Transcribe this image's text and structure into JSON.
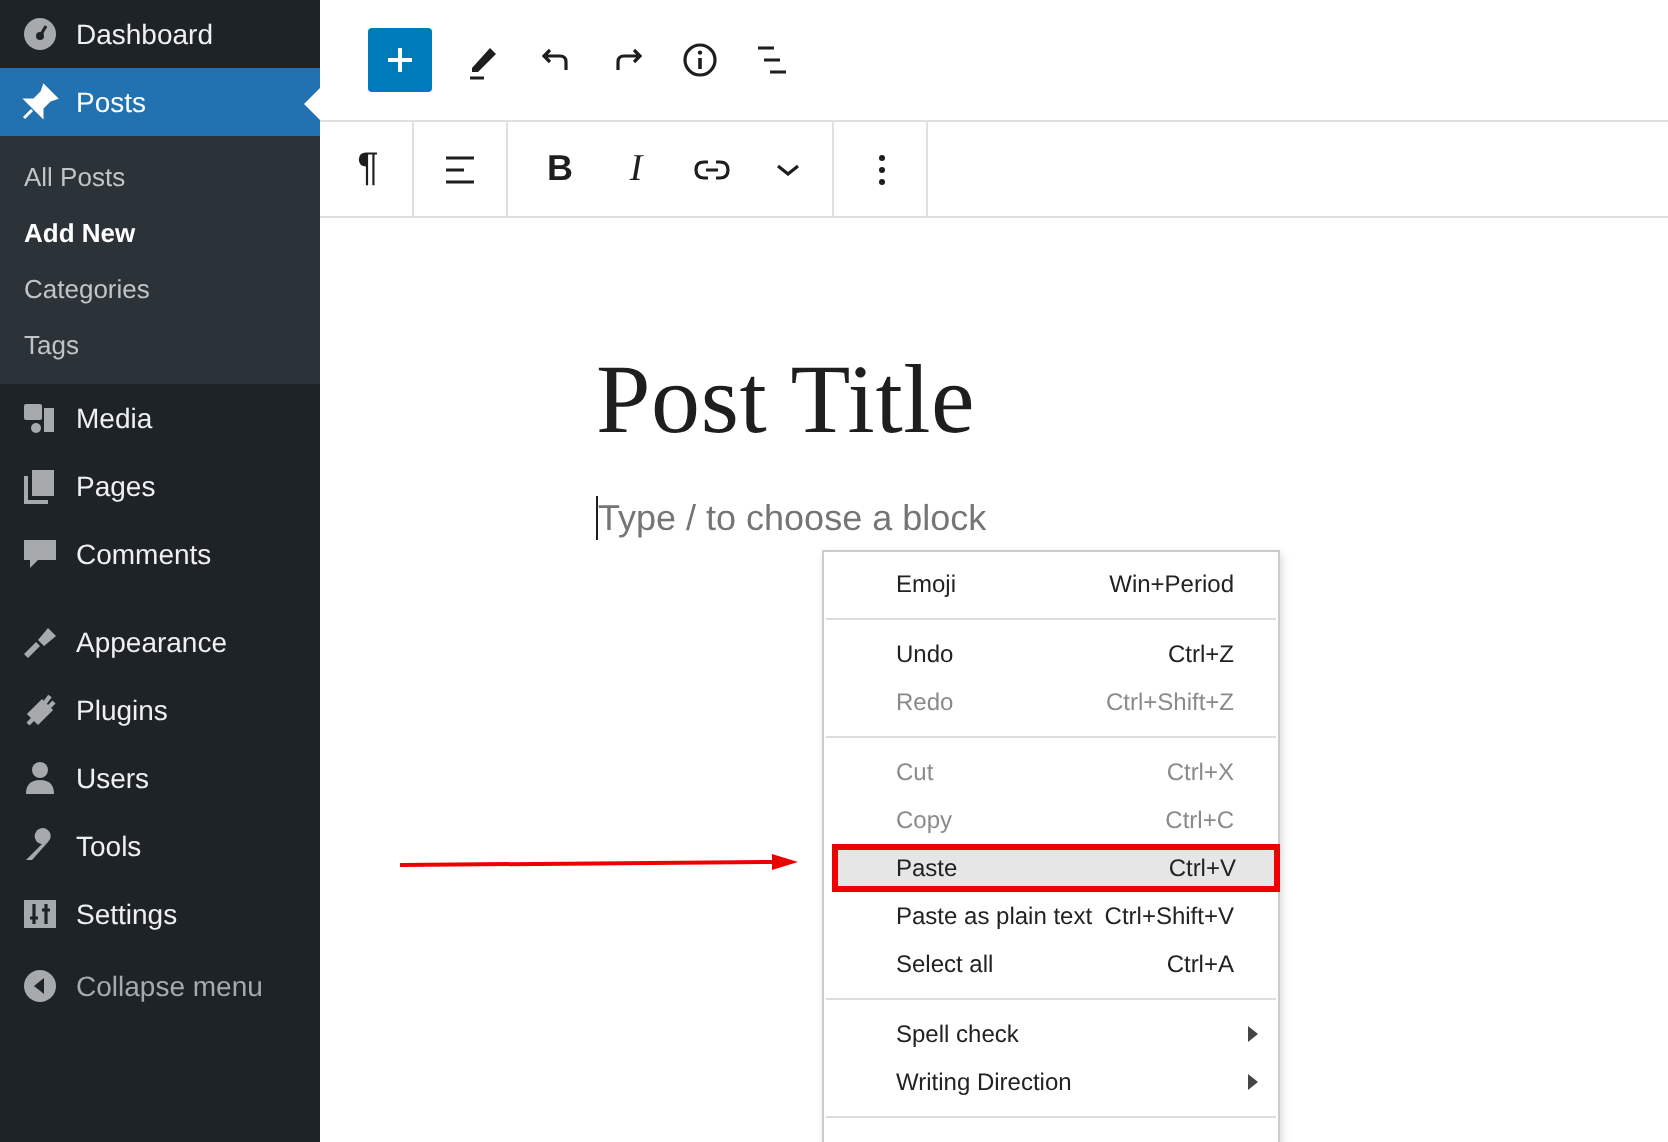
{
  "sidebar": {
    "items": [
      {
        "label": "Dashboard",
        "selected": false
      },
      {
        "label": "Posts",
        "selected": true,
        "children": [
          {
            "label": "All Posts",
            "selected": false
          },
          {
            "label": "Add New",
            "selected": true
          },
          {
            "label": "Categories",
            "selected": false
          },
          {
            "label": "Tags",
            "selected": false
          }
        ]
      },
      {
        "label": "Media",
        "selected": false
      },
      {
        "label": "Pages",
        "selected": false
      },
      {
        "label": "Comments",
        "selected": false
      },
      {
        "label": "Appearance",
        "selected": false
      },
      {
        "label": "Plugins",
        "selected": false
      },
      {
        "label": "Users",
        "selected": false
      },
      {
        "label": "Tools",
        "selected": false
      },
      {
        "label": "Settings",
        "selected": false
      },
      {
        "label": "Collapse menu",
        "selected": false,
        "kind": "collapse"
      }
    ]
  },
  "block_toolbar": {
    "paragraph": "¶",
    "bold": "B",
    "italic": "I"
  },
  "editor": {
    "title": "Post Title",
    "placeholder": "Type / to choose a block"
  },
  "context_menu": [
    {
      "kind": "item",
      "label": "Emoji",
      "shortcut": "Win+Period",
      "disabled": false
    },
    {
      "kind": "separator"
    },
    {
      "kind": "item",
      "label": "Undo",
      "shortcut": "Ctrl+Z",
      "disabled": false
    },
    {
      "kind": "item",
      "label": "Redo",
      "shortcut": "Ctrl+Shift+Z",
      "disabled": true
    },
    {
      "kind": "separator"
    },
    {
      "kind": "item",
      "label": "Cut",
      "shortcut": "Ctrl+X",
      "disabled": true
    },
    {
      "kind": "item",
      "label": "Copy",
      "shortcut": "Ctrl+C",
      "disabled": true
    },
    {
      "kind": "item",
      "label": "Paste",
      "shortcut": "Ctrl+V",
      "disabled": false,
      "selected": true
    },
    {
      "kind": "item",
      "label": "Paste as plain text",
      "shortcut": "Ctrl+Shift+V",
      "disabled": false
    },
    {
      "kind": "item",
      "label": "Select all",
      "shortcut": "Ctrl+A",
      "disabled": false
    },
    {
      "kind": "separator"
    },
    {
      "kind": "submenu",
      "label": "Spell check",
      "disabled": false
    },
    {
      "kind": "submenu",
      "label": "Writing Direction",
      "disabled": false
    },
    {
      "kind": "separator"
    }
  ]
}
